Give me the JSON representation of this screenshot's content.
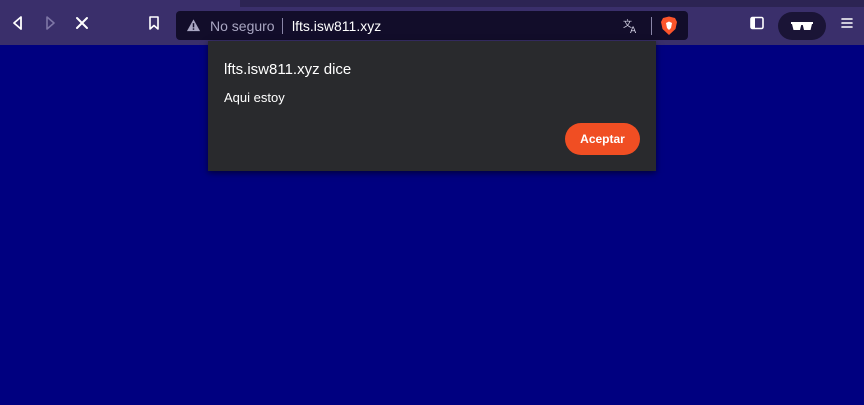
{
  "browser": {
    "security_label": "No seguro",
    "url": "lfts.isw811.xyz",
    "icons": {
      "back": "back-arrow-icon",
      "forward": "forward-arrow-icon",
      "stop": "stop-loading-icon",
      "bookmark": "bookmark-icon",
      "warning": "not-secure-warning-icon",
      "translate": "translate-icon",
      "shield": "brave-shields-icon",
      "sidebar": "sidebar-toggle-icon",
      "private": "private-glasses-icon",
      "menu": "menu-icon"
    }
  },
  "dialog": {
    "title": "lfts.isw811.xyz dice",
    "message": "Aqui estoy",
    "ok_label": "Aceptar"
  },
  "colors": {
    "page_background": "#000080",
    "toolbar": "#3a2f6b",
    "dialog_background": "#292a2d",
    "accent": "#f04e23"
  }
}
